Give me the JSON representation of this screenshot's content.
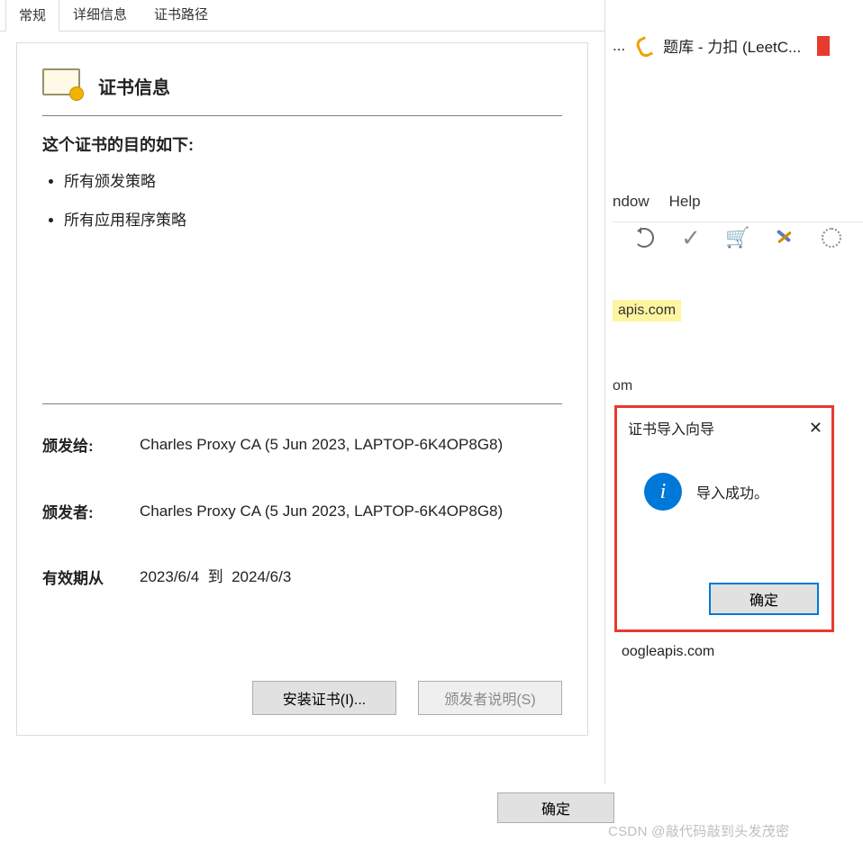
{
  "cert_dialog": {
    "tabs": {
      "general": "常规",
      "details": "详细信息",
      "path": "证书路径"
    },
    "header_title": "证书信息",
    "purpose_heading": "这个证书的目的如下:",
    "purposes": [
      "所有颁发策略",
      "所有应用程序策略"
    ],
    "issued_to_label": "颁发给:",
    "issued_to_value": "Charles Proxy CA (5 Jun 2023, LAPTOP-6K4OP8G8)",
    "issuer_label": "颁发者:",
    "issuer_value": "Charles Proxy CA (5 Jun 2023, LAPTOP-6K4OP8G8)",
    "validity_label": "有效期从",
    "validity_from": "2023/6/4",
    "validity_to_word": "到",
    "validity_to": "2024/6/3",
    "install_button": "安装证书(I)...",
    "issuer_statement_button": "颁发者说明(S)",
    "ok_button": "确定"
  },
  "browser_tab": {
    "ellipsis": "...",
    "title": "题库 - 力扣 (LeetC..."
  },
  "charles": {
    "menu": {
      "window_partial": "ndow",
      "help": "Help"
    },
    "hosts": {
      "highlighted": "apis.com",
      "item2": "om",
      "item3": "oogleapis.com"
    }
  },
  "wizard": {
    "title": "证书导入向导",
    "message": "导入成功。",
    "ok": "确定"
  },
  "watermark": "CSDN @敲代码敲到头发茂密"
}
